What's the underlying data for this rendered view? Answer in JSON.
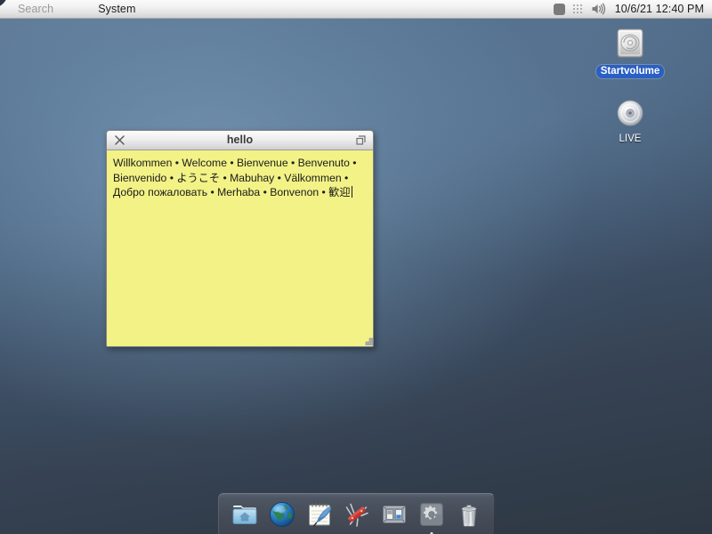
{
  "menubar": {
    "search_label": "Search",
    "system_label": "System",
    "clock": "10/6/21 12:40 PM",
    "tray": [
      {
        "name": "app-indicator-icon",
        "label": "square-indicator"
      },
      {
        "name": "grid-icon",
        "label": "dot-grid"
      },
      {
        "name": "volume-icon",
        "label": "speaker"
      }
    ]
  },
  "desktop_icons": [
    {
      "id": "startvolume",
      "label": "Startvolume",
      "icon": "hard-drive-icon",
      "selected": true
    },
    {
      "id": "live",
      "label": "LIVE",
      "icon": "optical-disc-icon",
      "selected": false
    }
  ],
  "window": {
    "title": "hello",
    "close_label": "Close",
    "maximize_label": "Maximize",
    "background_color": "#f2f286",
    "text": "Willkommen • Welcome • Bienvenue • Benvenuto • Bienvenido • ようこそ • Mabuhay • Välkommen • Добро пожаловать • Merhaba • Bonvenon • 歓迎"
  },
  "dock": {
    "items": [
      {
        "id": "files",
        "name": "home-folder-icon",
        "label": "Home",
        "running": false
      },
      {
        "id": "browser",
        "name": "globe-icon",
        "label": "Web Browser",
        "running": false
      },
      {
        "id": "editor",
        "name": "notepad-quill-icon",
        "label": "Text Editor",
        "running": false
      },
      {
        "id": "utilities",
        "name": "pocket-knife-icon",
        "label": "Utilities",
        "running": false
      },
      {
        "id": "preferences",
        "name": "panels-icon",
        "label": "Preferences",
        "running": false
      },
      {
        "id": "settings",
        "name": "gear-icon",
        "label": "System Settings",
        "running": true
      },
      {
        "id": "trash",
        "name": "trash-icon",
        "label": "Trash",
        "running": false
      }
    ]
  },
  "colors": {
    "accent_selection": "#2a5fc4",
    "note_yellow": "#f2f286",
    "dock_bg": "#4a515d",
    "desktop_top": "#5e7894",
    "desktop_bottom": "#2e3844"
  }
}
